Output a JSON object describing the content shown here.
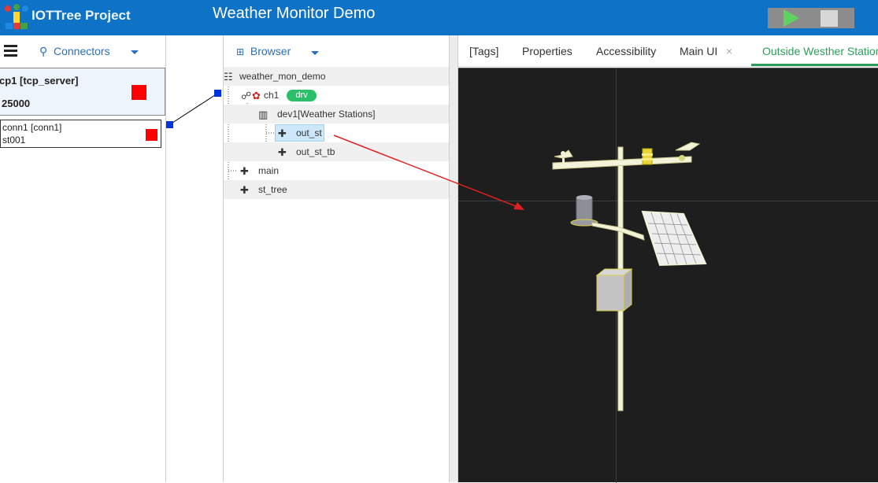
{
  "header": {
    "app_title": "IOTTree Project",
    "project_title": "Weather Monitor Demo"
  },
  "left": {
    "connectors_label": "Connectors",
    "tcp_name": "cp1 [tcp_server]",
    "tcp_port": "25000",
    "conn_line1": "conn1 [conn1]",
    "conn_line2": "st001"
  },
  "browser": {
    "header_label": "Browser",
    "tree": {
      "root": "weather_mon_demo",
      "ch1": "ch1",
      "drv": "drv",
      "dev1": "dev1[Weather Stations]",
      "out_st": "out_st",
      "out_st_tb": "out_st_tb",
      "main": "main",
      "st_tree": "st_tree"
    }
  },
  "tabs": {
    "tags": "[Tags]",
    "properties": "Properties",
    "accessibility": "Accessibility",
    "main_ui": "Main UI",
    "close": "×",
    "outside": "Outside Westher Station"
  },
  "colors": {
    "topbar": "#0e73c6",
    "accent_green": "#2b9e5a",
    "link_blue": "#2a6fbd",
    "alarm_red": "#ff0000",
    "canvas_bg": "#1e1e1e",
    "arrow_red": "#e02020"
  },
  "icons": {
    "menu": "hamburger-icon",
    "connectors": "link-icon",
    "browser": "hierarchy-icon",
    "play": "play-icon",
    "stop": "stop-icon"
  }
}
